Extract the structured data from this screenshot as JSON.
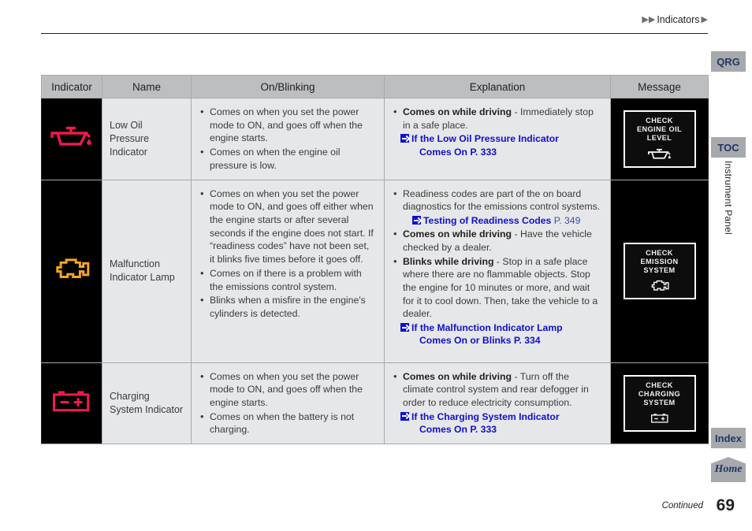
{
  "breadcrumb": {
    "arrow_left": "▶▶",
    "text": "Indicators",
    "arrow_right": "▶"
  },
  "table": {
    "headers": [
      "Indicator",
      "Name",
      "On/Blinking",
      "Explanation",
      "Message"
    ],
    "rows": [
      {
        "indicator_icon": "low-oil-pressure-icon",
        "indicator_color": "#ED1A4B",
        "name": "Low Oil Pressure Indicator",
        "on_blinking": [
          "Comes on when you set the power mode to ON, and goes off when the engine starts.",
          "Comes on when the engine oil pressure is low."
        ],
        "explanation": [
          {
            "bold": "Comes on while driving",
            "rest": " - Immediately stop in a safe place."
          }
        ],
        "reference": {
          "title_line1": "If the Low Oil Pressure Indicator",
          "title_line2": "Comes On",
          "page": "P. 333"
        },
        "message": {
          "lines": [
            "CHECK",
            "ENGINE OIL",
            "LEVEL"
          ],
          "glyph": "oil-can-glyph"
        }
      },
      {
        "indicator_icon": "malfunction-indicator-lamp-icon",
        "indicator_color": "#F5A623",
        "name": "Malfunction Indicator Lamp",
        "on_blinking": [
          "Comes on when you set the power mode to ON, and goes off either when the engine starts or after several seconds if the engine does not start. If “readiness codes” have not been set, it blinks five times before it goes off.",
          "Comes on if there is a problem with the emissions control system.",
          "Blinks when a misfire in the engine's cylinders is detected."
        ],
        "explanation": [
          {
            "bold": "",
            "rest": "Readiness codes are part of the on board diagnostics for the emissions control systems."
          },
          {
            "bold": "Comes on while driving",
            "rest": " - Have the vehicle checked by a dealer."
          },
          {
            "bold": "Blinks while driving",
            "rest": " - Stop in a safe place where there are no flammable objects. Stop the engine for 10 minutes or more, and wait for it to cool down. Then, take the vehicle to a dealer."
          }
        ],
        "reference_inline": {
          "title": "Testing of Readiness Codes",
          "page": "P. 349"
        },
        "reference": {
          "title_line1": "If the Malfunction Indicator Lamp",
          "title_line2": "Comes On or Blinks",
          "page": "P. 334"
        },
        "message": {
          "lines": [
            "CHECK",
            "EMISSION",
            "SYSTEM"
          ],
          "glyph": "engine-glyph"
        }
      },
      {
        "indicator_icon": "charging-system-icon",
        "indicator_color": "#ED1A4B",
        "name": "Charging System Indicator",
        "on_blinking": [
          "Comes on when you set the power mode to ON, and goes off when the engine starts.",
          "Comes on when the battery is not charging."
        ],
        "explanation": [
          {
            "bold": "Comes on while driving",
            "rest": " - Turn off the climate control system and rear defogger in order to reduce electricity consumption."
          }
        ],
        "reference": {
          "title_line1": "If the Charging System Indicator",
          "title_line2": "Comes On",
          "page": "P. 333"
        },
        "message": {
          "lines": [
            "CHECK",
            "CHARGING",
            "SYSTEM"
          ],
          "glyph": "battery-glyph"
        }
      }
    ]
  },
  "sidebar": {
    "qrg": "QRG",
    "toc": "TOC",
    "section_label": "Instrument Panel",
    "index": "Index",
    "home": "Home"
  },
  "footer": {
    "continued": "Continued",
    "page_number": "69"
  },
  "colors": {
    "link": "#1010cf",
    "header_bg": "#bcbec0",
    "cell_bg": "#e6e7e8",
    "sidebar_btn": "#a7a9ac",
    "sidebar_text": "#1f3864"
  }
}
